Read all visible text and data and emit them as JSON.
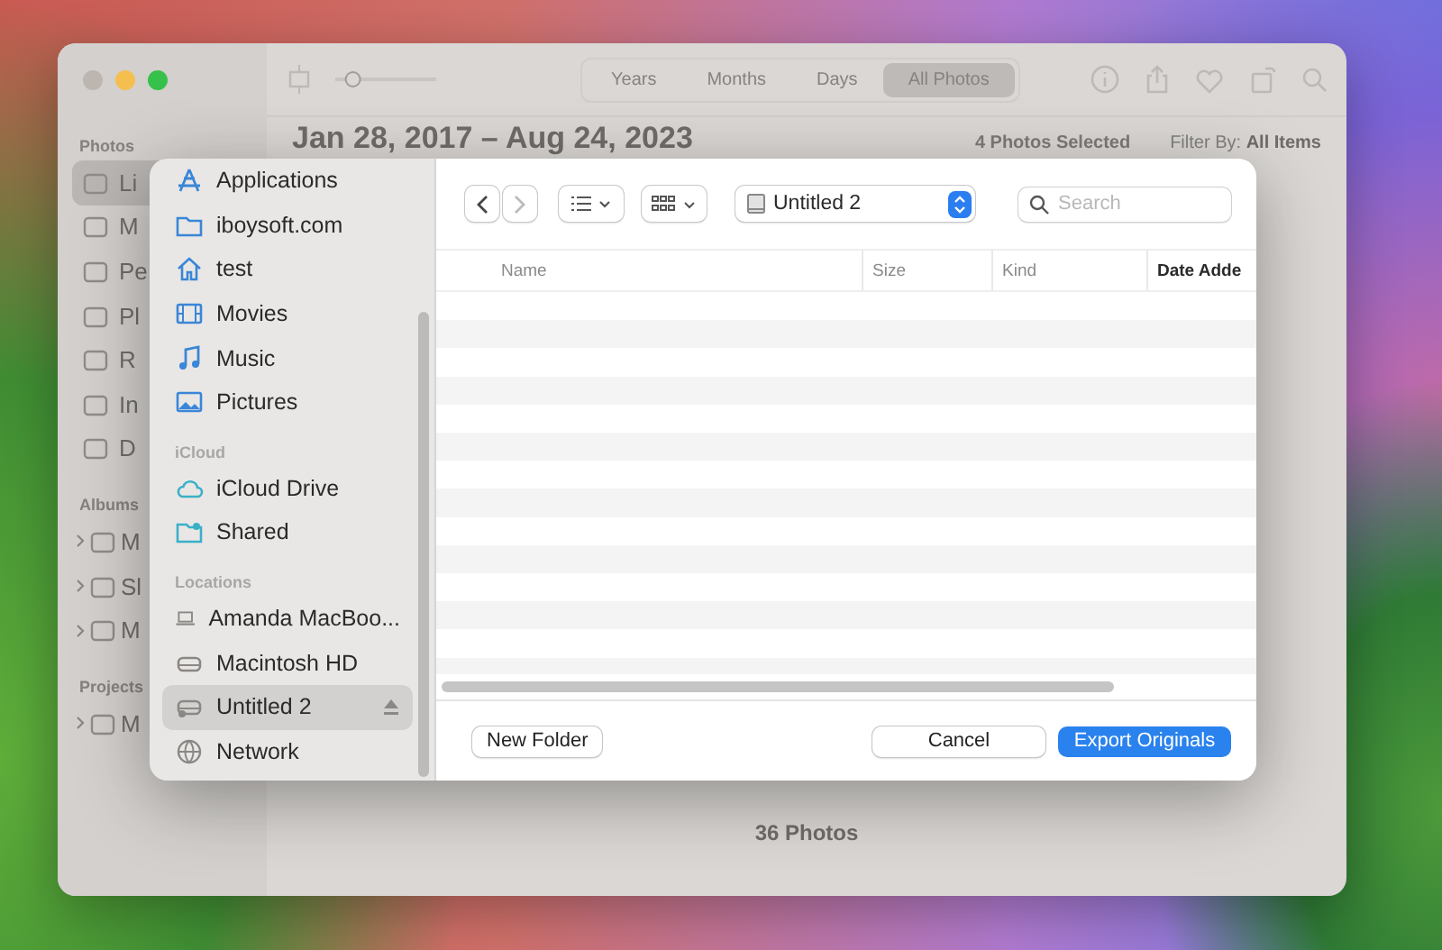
{
  "photos_window": {
    "toolbar": {
      "zoom": {
        "level": 0.15
      },
      "segments": [
        {
          "label": "Years",
          "selected": false
        },
        {
          "label": "Months",
          "selected": false
        },
        {
          "label": "Days",
          "selected": false
        },
        {
          "label": "All Photos",
          "selected": true
        }
      ]
    },
    "sidebar": {
      "sections": [
        {
          "title": "Photos",
          "items": [
            {
              "label": "Li",
              "selected": true
            },
            {
              "label": "M",
              "selected": false
            },
            {
              "label": "Pe",
              "selected": false
            },
            {
              "label": "Pl",
              "selected": false
            },
            {
              "label": "R",
              "selected": false
            },
            {
              "label": "In",
              "selected": false
            },
            {
              "label": "D",
              "selected": false
            }
          ]
        },
        {
          "title": "Albums",
          "items": [
            {
              "label": "M",
              "selected": false
            },
            {
              "label": "Sl",
              "selected": false
            },
            {
              "label": "M",
              "selected": false
            }
          ]
        },
        {
          "title": "Projects",
          "items": [
            {
              "label": "M",
              "selected": false
            }
          ]
        }
      ]
    },
    "title": "Jan 28, 2017 – Aug 24, 2023",
    "selection_count": "4 Photos Selected",
    "filter": {
      "label": "Filter By:",
      "value": "All Items"
    },
    "footer": "36 Photos"
  },
  "dialog": {
    "sidebar": {
      "sections": [
        {
          "items": [
            {
              "label": "Applications",
              "selected": false,
              "ejectable": false
            },
            {
              "label": "iboysoft.com",
              "selected": false,
              "ejectable": false
            },
            {
              "label": "test",
              "selected": false,
              "ejectable": false
            },
            {
              "label": "Movies",
              "selected": false,
              "ejectable": false
            },
            {
              "label": "Music",
              "selected": false,
              "ejectable": false
            },
            {
              "label": "Pictures",
              "selected": false,
              "ejectable": false
            }
          ]
        },
        {
          "title": "iCloud",
          "items": [
            {
              "label": "iCloud Drive",
              "selected": false,
              "ejectable": false
            },
            {
              "label": "Shared",
              "selected": false,
              "ejectable": false
            }
          ]
        },
        {
          "title": "Locations",
          "items": [
            {
              "label": "Amanda MacBoo...",
              "selected": false,
              "ejectable": false
            },
            {
              "label": "Macintosh HD",
              "selected": false,
              "ejectable": false
            },
            {
              "label": "Untitled 2",
              "selected": true,
              "ejectable": true
            },
            {
              "label": "Network",
              "selected": false,
              "ejectable": false
            }
          ]
        }
      ]
    },
    "location": "Untitled 2",
    "search": {
      "placeholder": "Search"
    },
    "columns": [
      {
        "label": "Name",
        "sorted": false
      },
      {
        "label": "Size",
        "sorted": false
      },
      {
        "label": "Kind",
        "sorted": false
      },
      {
        "label": "Date Adde",
        "sorted": true
      }
    ],
    "buttons": [
      {
        "label": "New Folder",
        "kind": "secondary"
      },
      {
        "label": "Cancel",
        "kind": "secondary"
      },
      {
        "label": "Export Originals",
        "kind": "primary"
      }
    ]
  }
}
